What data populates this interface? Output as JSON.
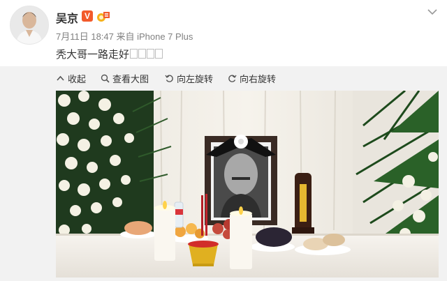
{
  "post": {
    "author": "吴京",
    "verified_badge": "V",
    "meta": "7月11日 18:47 来自 iPhone 7 Plus",
    "text": "秃大哥一路走好"
  },
  "toolbar": {
    "collapse": "收起",
    "view_large": "查看大图",
    "rotate_left": "向左旋转",
    "rotate_right": "向右旋转"
  },
  "icons": [
    "avatar",
    "verified-v-icon",
    "medal-icon",
    "chevron-down-icon",
    "collapse-icon",
    "search-icon",
    "rotate-left-icon",
    "rotate-right-icon"
  ],
  "colors": {
    "accent": "#f25a2b",
    "meta": "#808080",
    "panel": "#f2f2f2"
  }
}
